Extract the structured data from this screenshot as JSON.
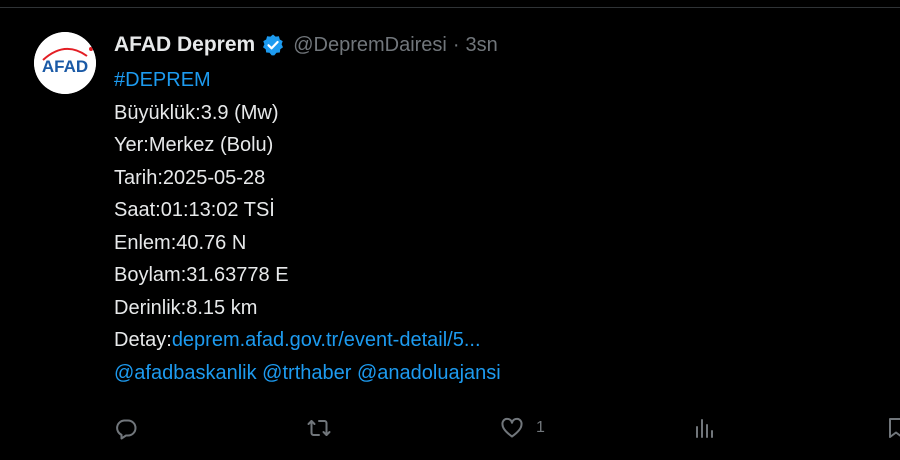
{
  "tweet": {
    "avatar_text": "AFAD",
    "author_name": "AFAD Deprem",
    "handle": "@DepremDairesi",
    "separator": "·",
    "time": "3sn",
    "hashtag": "#DEPREM",
    "lines": [
      "Büyüklük:3.9 (Mw)",
      "Yer:Merkez (Bolu)",
      "Tarih:2025-05-28",
      "Saat:01:13:02 TSİ",
      "Enlem:40.76 N",
      "Boylam:31.63778 E",
      "Derinlik:8.15 km"
    ],
    "detail_label": "Detay:",
    "detail_link": "deprem.afad.gov.tr/event-detail/5...",
    "mentions": [
      "@afadbaskanlik",
      "@trthaber",
      "@anadoluajansi"
    ]
  },
  "actions": {
    "reply_icon": "reply-icon",
    "retweet_icon": "retweet-icon",
    "like_icon": "heart-icon",
    "like_count": "1",
    "views_icon": "views-icon",
    "bookmark_icon": "bookmark-icon"
  },
  "colors": {
    "background": "#000000",
    "text": "#e7e9ea",
    "muted": "#71767b",
    "link": "#1d9bf0",
    "brand_blue": "#1b5aa6",
    "brand_red": "#e31e24"
  }
}
